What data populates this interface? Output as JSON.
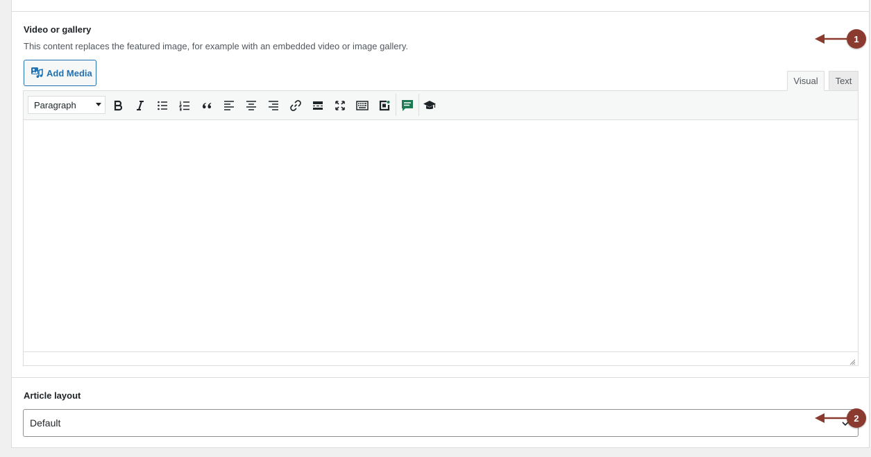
{
  "video_gallery": {
    "label": "Video or gallery",
    "description": "This content replaces the featured image, for example with an embedded video or image gallery.",
    "add_media_label": "Add Media",
    "tabs": {
      "visual": "Visual",
      "text": "Text"
    },
    "format_select": "Paragraph"
  },
  "article_layout": {
    "label": "Article layout",
    "selected": "Default"
  },
  "annotations": [
    "1",
    "2"
  ],
  "colors": {
    "accent": "#2271b1",
    "annotation": "#8b3a2f",
    "chat_icon": "#1e7a53"
  },
  "toolbar_icons": [
    "bold-icon",
    "italic-icon",
    "bullet-list-icon",
    "numbered-list-icon",
    "blockquote-icon",
    "align-left-icon",
    "align-center-icon",
    "align-right-icon",
    "link-icon",
    "read-more-icon",
    "fullscreen-icon",
    "toolbar-toggle-icon",
    "embed-icon",
    "chat-icon",
    "graduation-cap-icon"
  ]
}
